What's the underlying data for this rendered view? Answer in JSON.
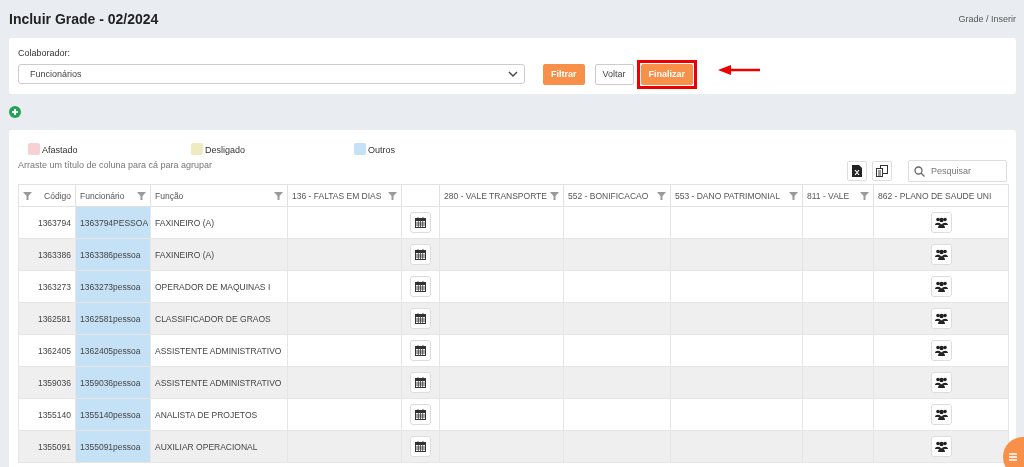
{
  "page": {
    "title": "Incluir Grade - 02/2024",
    "breadcrumb": "Grade / Inserir"
  },
  "filter": {
    "label": "Colaborador:",
    "value": "Funcionários",
    "buttons": [
      {
        "label": "Filtrar",
        "kind": "primary",
        "highlighted": false
      },
      {
        "label": "Voltar",
        "kind": "default",
        "highlighted": false
      },
      {
        "label": "Finalizar",
        "kind": "primary",
        "highlighted": true
      }
    ]
  },
  "legend": [
    {
      "label": "Afastado",
      "color": "#f8d0d3"
    },
    {
      "label": "Desligado",
      "color": "#eeeac2"
    },
    {
      "label": "Outros",
      "color": "#c5e1f5"
    }
  ],
  "group_hint": "Arraste um título de coluna para cá para agrupar",
  "search": {
    "placeholder": "Pesquisar"
  },
  "table": {
    "columns": [
      {
        "label": "Código",
        "filter": true,
        "kind": "code"
      },
      {
        "label": "Funcionário",
        "filter": true,
        "kind": "name"
      },
      {
        "label": "Função",
        "filter": true,
        "kind": "text"
      },
      {
        "label": "136 - FALTAS EM DIAS",
        "filter": true,
        "kind": "text"
      },
      {
        "filter": false,
        "kind": "calendar"
      },
      {
        "label": "280 - VALE TRANSPORTE",
        "filter": true,
        "kind": "text"
      },
      {
        "label": "552 - BONIFICACAO",
        "filter": true,
        "kind": "text"
      },
      {
        "label": "553 - DANO PATRIMONIAL",
        "filter": true,
        "kind": "text"
      },
      {
        "label": "811 - VALE",
        "filter": true,
        "kind": "text"
      },
      {
        "label": "862 - PLANO DE SAUDE UNI",
        "filter": false,
        "kind": "people"
      }
    ],
    "rows": [
      {
        "code": "1363794",
        "name": "1363794PESSOA",
        "role": "FAXINEIRO (A)"
      },
      {
        "code": "1363386",
        "name": "1363386pessoa",
        "role": "FAXINEIRO (A)"
      },
      {
        "code": "1363273",
        "name": "1363273pessoa",
        "role": "OPERADOR DE MAQUINAS I"
      },
      {
        "code": "1362581",
        "name": "1362581pessoa",
        "role": "CLASSIFICADOR DE GRAOS"
      },
      {
        "code": "1362405",
        "name": "1362405pessoa",
        "role": "ASSISTENTE ADMINISTRATIVO"
      },
      {
        "code": "1359036",
        "name": "1359036pessoa",
        "role": "ASSISTENTE ADMINISTRATIVO"
      },
      {
        "code": "1355140",
        "name": "1355140pessoa",
        "role": "ANALISTA DE PROJETOS"
      },
      {
        "code": "1355091",
        "name": "1355091pessoa",
        "role": "AUXILIAR OPERACIONAL"
      }
    ]
  }
}
